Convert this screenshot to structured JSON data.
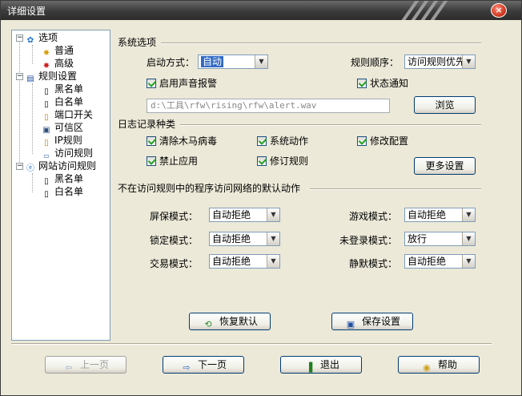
{
  "window": {
    "title": "详细设置",
    "close_glyph": "×"
  },
  "tree": {
    "options": "选项",
    "normal": "普通",
    "advanced": "高级",
    "rules": "规则设置",
    "blacklist": "黑名单",
    "whitelist": "白名单",
    "port_switch": "端口开关",
    "trusted_zone": "可信区",
    "ip_rules": "IP规则",
    "access_rules": "访问规则",
    "web_access_rules": "网站访问规则",
    "web_blacklist": "黑名单",
    "web_whitelist": "白名单"
  },
  "system": {
    "section_title": "系统选项",
    "start_mode_label": "启动方式：",
    "start_mode_value": "自动",
    "rule_order_label": "规则顺序：",
    "rule_order_value": "访问规则优先",
    "sound_alarm_label": "启用声音报警",
    "sound_alarm_checked": true,
    "status_notify_label": "状态通知",
    "status_notify_checked": true,
    "sound_path": "d:\\工具\\rfw\\rising\\rfw\\alert.wav",
    "browse_label": "浏览"
  },
  "log": {
    "section_title": "日志记录种类",
    "items": [
      {
        "label": "清除木马病毒",
        "checked": true
      },
      {
        "label": "系统动作",
        "checked": true
      },
      {
        "label": "修改配置",
        "checked": true
      },
      {
        "label": "禁止应用",
        "checked": true
      },
      {
        "label": "修订规则",
        "checked": true
      }
    ],
    "more_label": "更多设置"
  },
  "default_action": {
    "section_title": "不在访问规则中的程序访问网络的默认动作",
    "screensaver_label": "屏保模式：",
    "screensaver_value": "自动拒绝",
    "game_label": "游戏模式：",
    "game_value": "自动拒绝",
    "lock_label": "锁定模式：",
    "lock_value": "自动拒绝",
    "notlogged_label": "未登录模式：",
    "notlogged_value": "放行",
    "trade_label": "交易模式：",
    "trade_value": "自动拒绝",
    "silent_label": "静默模式：",
    "silent_value": "自动拒绝"
  },
  "actions": {
    "restore_label": "恢复默认",
    "save_label": "保存设置"
  },
  "nav": {
    "prev_label": "上一页",
    "next_label": "下一页",
    "exit_label": "退出",
    "help_label": "帮助"
  },
  "colors": {
    "accent": "#316ac5",
    "check": "#21a121",
    "face": "#ece9d8"
  }
}
